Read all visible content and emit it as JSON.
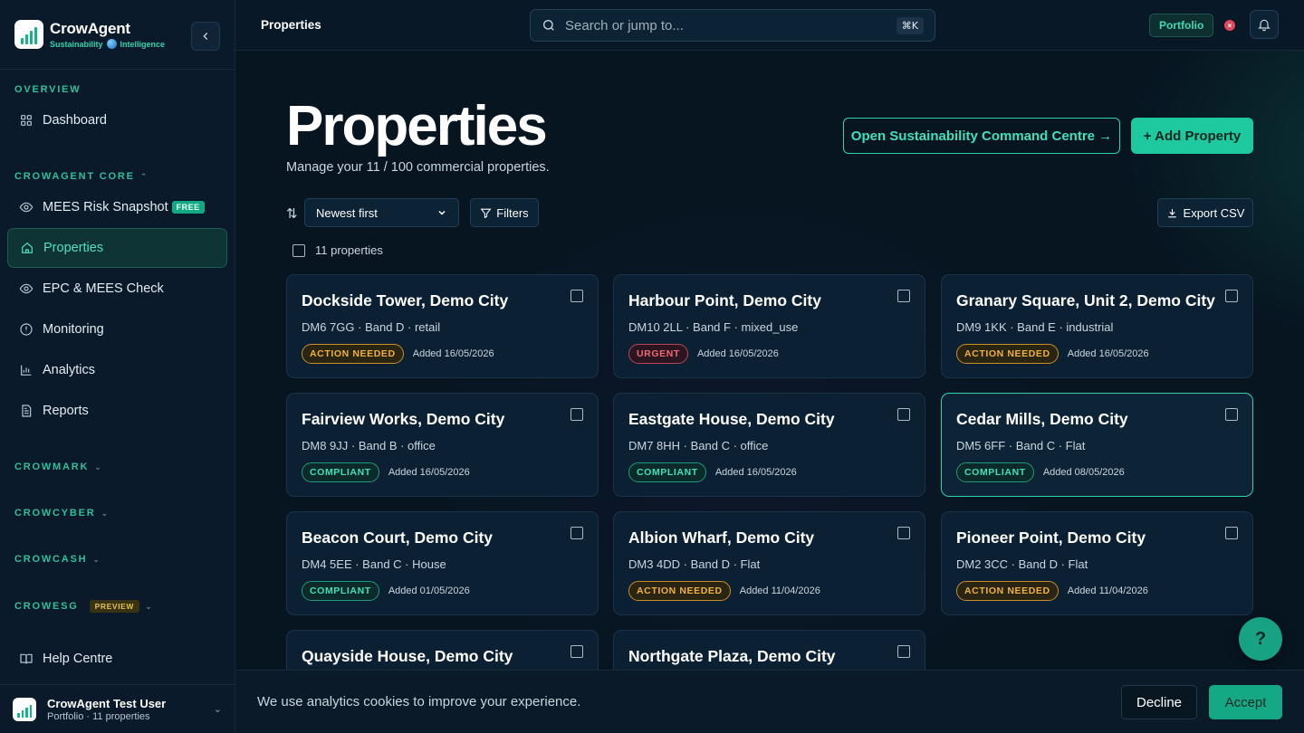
{
  "brand": {
    "name": "CrowAgent",
    "tag_left": "Sustainability",
    "tag_right": "Intelligence"
  },
  "sidebar": {
    "sections": {
      "overview": "OVERVIEW",
      "core": "CROWAGENT CORE",
      "crowmark": "CROWMARK",
      "crowcyber": "CROWCYBER",
      "crowcash": "CROWCASH",
      "crowesg": "CROWESG",
      "crowesg_badge": "PREVIEW"
    },
    "items": {
      "dashboard": "Dashboard",
      "mees": "MEES Risk Snapshot",
      "mees_badge": "FREE",
      "properties": "Properties",
      "epc": "EPC & MEES Check",
      "monitoring": "Monitoring",
      "analytics": "Analytics",
      "reports": "Reports"
    },
    "help": "Help Centre",
    "user": {
      "name": "CrowAgent Test User",
      "sub": "Portfolio · 11 properties"
    }
  },
  "topbar": {
    "breadcrumb": "Properties",
    "search_placeholder": "Search or jump to...",
    "search_shortcut": "⌘K",
    "portfolio": "Portfolio"
  },
  "page": {
    "title": "Properties",
    "subtitle": "Manage your 11 / 100 commercial properties.",
    "command_centre": "Open Sustainability Command Centre →",
    "add_property": "+ Add Property",
    "sort_value": "Newest first",
    "filters": "Filters",
    "export": "Export CSV",
    "count": "11 properties"
  },
  "properties": [
    {
      "name": "Dockside Tower, Demo City",
      "meta": "DM6 7GG · Band D · retail",
      "status": "ACTION NEEDED",
      "kind": "action",
      "added": "Added 16/05/2026"
    },
    {
      "name": "Harbour Point, Demo City",
      "meta": "DM10 2LL · Band F · mixed_use",
      "status": "URGENT",
      "kind": "urgent",
      "added": "Added 16/05/2026"
    },
    {
      "name": "Granary Square, Unit 2, Demo City",
      "meta": "DM9 1KK · Band E · industrial",
      "status": "ACTION NEEDED",
      "kind": "action",
      "added": "Added 16/05/2026"
    },
    {
      "name": "Fairview Works, Demo City",
      "meta": "DM8 9JJ · Band B · office",
      "status": "COMPLIANT",
      "kind": "compliant",
      "added": "Added 16/05/2026"
    },
    {
      "name": "Eastgate House, Demo City",
      "meta": "DM7 8HH · Band C · office",
      "status": "COMPLIANT",
      "kind": "compliant",
      "added": "Added 16/05/2026"
    },
    {
      "name": "Cedar Mills, Demo City",
      "meta": "DM5 6FF · Band C · Flat",
      "status": "COMPLIANT",
      "kind": "compliant",
      "added": "Added 08/05/2026"
    },
    {
      "name": "Beacon Court, Demo City",
      "meta": "DM4 5EE · Band C · House",
      "status": "COMPLIANT",
      "kind": "compliant",
      "added": "Added 01/05/2026"
    },
    {
      "name": "Albion Wharf, Demo City",
      "meta": "DM3 4DD · Band D · Flat",
      "status": "ACTION NEEDED",
      "kind": "action",
      "added": "Added 11/04/2026"
    },
    {
      "name": "Pioneer Point, Demo City",
      "meta": "DM2 3CC · Band D · Flat",
      "status": "ACTION NEEDED",
      "kind": "action",
      "added": "Added 11/04/2026"
    },
    {
      "name": "Quayside House, Demo City",
      "meta": "",
      "status": "",
      "kind": "",
      "added": ""
    },
    {
      "name": "Northgate Plaza, Demo City",
      "meta": "",
      "status": "",
      "kind": "",
      "added": ""
    }
  ],
  "help_fab": "?",
  "cookie": {
    "text": "We use analytics cookies to improve your experience.",
    "decline": "Decline",
    "accept": "Accept"
  }
}
